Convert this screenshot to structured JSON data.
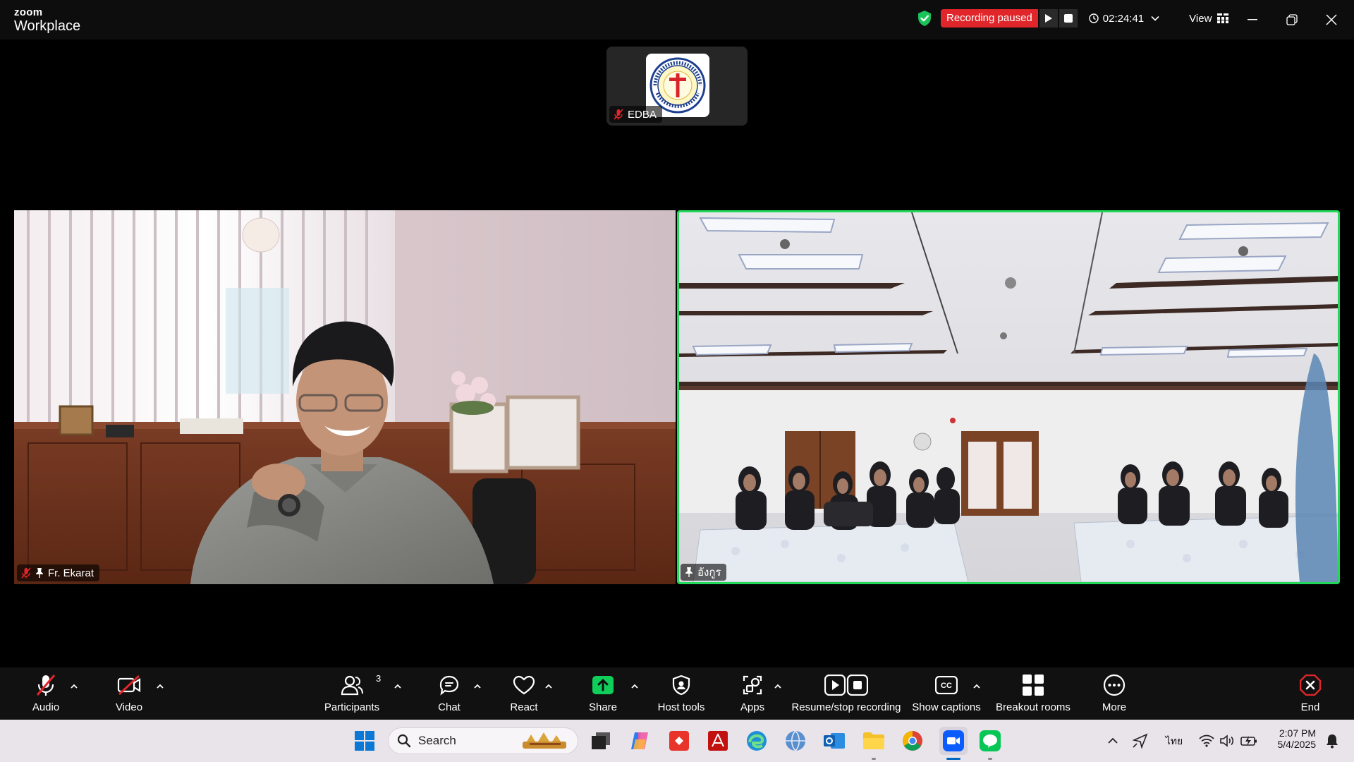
{
  "app": {
    "brand_top": "zoom",
    "brand_bottom": "Workplace"
  },
  "recording": {
    "status": "Recording paused",
    "elapsed": "02:24:41"
  },
  "view": {
    "label": "View"
  },
  "participants_view": {
    "thumbnail": {
      "name": "EDBA"
    },
    "tiles": [
      {
        "name": "Fr. Ekarat"
      },
      {
        "name": "อังกูร"
      }
    ]
  },
  "toolbar": {
    "audio": "Audio",
    "video": "Video",
    "participants": "Participants",
    "participants_count": "3",
    "chat": "Chat",
    "react": "React",
    "share": "Share",
    "host_tools": "Host tools",
    "apps": "Apps",
    "resume_recording": "Resume/stop recording",
    "show_captions": "Show captions",
    "breakout_rooms": "Breakout rooms",
    "more": "More",
    "end": "End"
  },
  "taskbar": {
    "search_placeholder": "Search",
    "language": "ไทย",
    "time": "2:07 PM",
    "date": "5/4/2025"
  },
  "colors": {
    "active_speaker": "#23d959",
    "recording": "#e0262a",
    "share": "#0fcf5a",
    "end": "#e0262a"
  }
}
